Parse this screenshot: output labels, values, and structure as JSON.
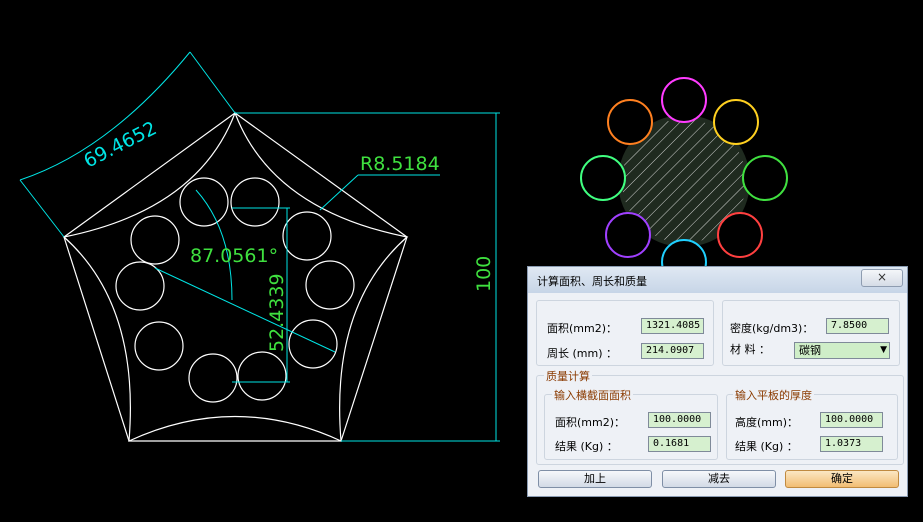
{
  "drawing": {
    "dim_arc": "69.4652",
    "dim_radius": "R8.5184",
    "dim_angle": "87.0561°",
    "dim_diag": "52.4339",
    "dim_height": "100"
  },
  "dialog": {
    "title": "计算面积、周长和质量",
    "close_glyph": "×",
    "area_label": "面积(mm2)：",
    "area_value": "1321.4085",
    "perim_label": "周长 (mm) ：",
    "perim_value": "214.0907",
    "density_label": "密度(kg/dm3)：",
    "density_value": "7.8500",
    "material_label": "材 料 ：",
    "material_value": "碳钢",
    "mass_group": "质量计算",
    "cross_group": "输入横截面面积",
    "cross_area_label": "面积(mm2)：",
    "cross_area_value": "100.0000",
    "cross_result_label": "结果 (Kg) ：",
    "cross_result_value": "0.1681",
    "plate_group": "输入平板的厚度",
    "plate_height_label": "高度(mm)：",
    "plate_height_value": "100.0000",
    "plate_result_label": "结果 (Kg) ：",
    "plate_result_value": "1.0373",
    "btn_add": "加上",
    "btn_sub": "减去",
    "btn_ok": "确定"
  }
}
